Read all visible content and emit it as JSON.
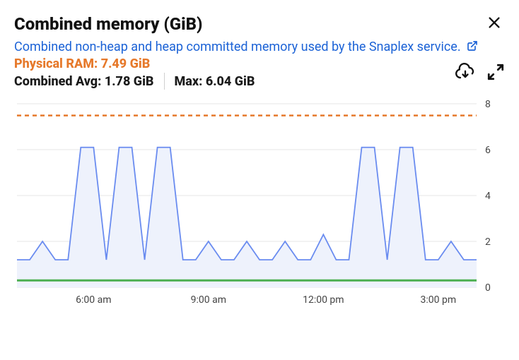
{
  "header": {
    "title": "Combined memory (GiB)",
    "description": "Combined non-heap and heap committed memory used by the Snaplex service."
  },
  "stats": {
    "physical_label": "Physical RAM:",
    "physical_value": "7.49 GiB",
    "avg_label": "Combined Avg:",
    "avg_value": "1.78 GiB",
    "max_label": "Max:",
    "max_value": "6.04 GiB"
  },
  "icons": {
    "close": "close-icon",
    "external": "external-link-icon",
    "download": "download-icon",
    "expand": "expand-icon"
  },
  "colors": {
    "accent_orange": "#e6792b",
    "link_blue": "#1b62d6",
    "series_blue": "#6a8cf0",
    "series_fill": "#eef2fc",
    "baseline_green": "#4caf50",
    "grid": "#e5e5e5",
    "threshold": "#e6792b"
  },
  "chart_data": {
    "type": "area",
    "title": "Combined memory (GiB)",
    "xlabel": "",
    "ylabel": "",
    "ylim": [
      0,
      8
    ],
    "y_ticks": [
      0,
      2,
      4,
      6,
      8
    ],
    "x_ticks": [
      "6:00 am",
      "9:00 am",
      "12:00 pm",
      "3:00 pm"
    ],
    "threshold": 7.49,
    "baseline": 0.3,
    "x": [
      "4:00",
      "4:20",
      "4:40",
      "5:00",
      "5:20",
      "5:40",
      "6:00",
      "6:20",
      "6:40",
      "7:00",
      "7:20",
      "7:40",
      "8:00",
      "8:20",
      "8:40",
      "9:00",
      "9:20",
      "9:40",
      "10:00",
      "10:20",
      "10:40",
      "11:00",
      "11:20",
      "11:40",
      "12:00",
      "12:20",
      "12:40",
      "13:00",
      "13:20",
      "13:40",
      "14:00",
      "14:20",
      "14:40",
      "15:00",
      "15:20",
      "15:40",
      "16:00"
    ],
    "series": [
      {
        "name": "Combined memory",
        "values": [
          1.2,
          1.2,
          2.0,
          1.2,
          1.2,
          6.1,
          6.1,
          1.2,
          6.1,
          6.1,
          1.2,
          6.1,
          6.1,
          1.2,
          1.2,
          2.0,
          1.2,
          1.2,
          2.0,
          1.2,
          1.2,
          2.0,
          1.2,
          1.2,
          2.3,
          1.2,
          1.2,
          6.1,
          6.1,
          1.2,
          6.1,
          6.1,
          1.2,
          1.2,
          2.0,
          1.2,
          1.2
        ]
      }
    ]
  }
}
